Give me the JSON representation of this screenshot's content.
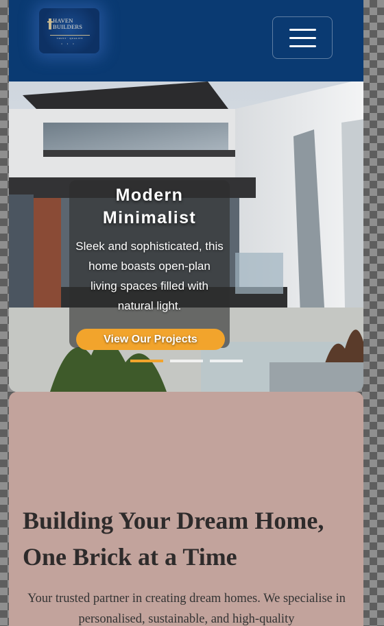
{
  "navbar": {
    "logo": {
      "name_line1": "HAVEN",
      "name_line2": "BUILDERS",
      "tagline": "TRUST · QUALITY",
      "dots": "•••"
    },
    "menu_toggle_icon": "hamburger-menu-icon"
  },
  "hero": {
    "title": "Modern Minimalist",
    "description": "Sleek and sophisticated, this home boasts open-plan living spaces filled with natural light.",
    "cta_label": "View Our Projects",
    "slides_total": 3,
    "active_slide": 1
  },
  "about": {
    "heading": "Building Your Dream Home, One Brick at a Time",
    "text": "Your trusted partner in creating dream homes. We specialise in personalised, sustainable, and high-quality"
  },
  "colors": {
    "navbar_bg": "#0a3a72",
    "accent": "#f2a42c",
    "about_bg": "#c2a39c"
  }
}
